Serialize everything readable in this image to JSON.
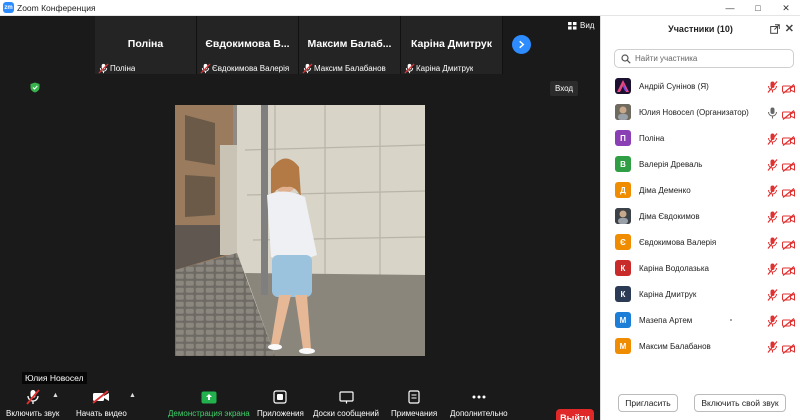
{
  "window": {
    "title": "Zoom Конференция",
    "logo_text": "zm",
    "controls": [
      "minimize",
      "maximize",
      "close"
    ]
  },
  "thumbnails": [
    {
      "big_name": "Поліна",
      "footer_name": "Поліна"
    },
    {
      "big_name": "Євдокимова В...",
      "footer_name": "Євдокимова Валерія"
    },
    {
      "big_name": "Максим Балаб...",
      "footer_name": "Максим Балабанов"
    },
    {
      "big_name": "Каріна Дмитрук",
      "footer_name": "Каріна Дмитрук"
    }
  ],
  "view_label": "Вид",
  "enter_label": "Вход",
  "active_speaker_tag": "Юлия Новосел",
  "toolbar": {
    "unmute": "Включить звук",
    "start_video": "Начать видео",
    "share_screen": "Демонстрация экрана",
    "apps": "Приложения",
    "whiteboards": "Доски сообщений",
    "notes": "Примечания",
    "more": "Дополнительно",
    "leave": "Выйти"
  },
  "panel": {
    "title": "Участники (10)",
    "search_placeholder": "Найти участника",
    "invite_label": "Пригласить",
    "unmute_me_label": "Включить свой звук",
    "participants": [
      {
        "name": "Андрій Сунінов (Я)",
        "initial": "",
        "avatar": "logo",
        "color": "#1b1030",
        "mic": "off",
        "video": "off"
      },
      {
        "name": "Юлия Новосел (Организатор)",
        "initial": "",
        "avatar": "photo",
        "color": "#6f6a60",
        "mic": "on",
        "video": "off"
      },
      {
        "name": "Поліна",
        "initial": "П",
        "avatar": "letter",
        "color": "#8a3fb5",
        "mic": "off",
        "video": "off"
      },
      {
        "name": "Валерія Древаль",
        "initial": "В",
        "avatar": "letter",
        "color": "#2f9e44",
        "mic": "off",
        "video": "off"
      },
      {
        "name": "Діма Деменко",
        "initial": "Д",
        "avatar": "letter",
        "color": "#f08c00",
        "mic": "off",
        "video": "off"
      },
      {
        "name": "Діма Євдокимов",
        "initial": "",
        "avatar": "photo",
        "color": "#3d4148",
        "mic": "off",
        "video": "off"
      },
      {
        "name": "Євдокимова Валерія",
        "initial": "Є",
        "avatar": "letter",
        "color": "#f08c00",
        "mic": "off",
        "video": "off"
      },
      {
        "name": "Каріна Водолазька",
        "initial": "К",
        "avatar": "letter",
        "color": "#c92a2a",
        "mic": "off",
        "video": "off"
      },
      {
        "name": "Каріна Дмитрук",
        "initial": "К",
        "avatar": "letter",
        "color": "#2b3a55",
        "mic": "off",
        "video": "off"
      },
      {
        "name": "Мазепа Артем",
        "initial": "М",
        "avatar": "letter",
        "color": "#1c7ed6",
        "mic": "off",
        "video": "off"
      },
      {
        "name": "Максим Балабанов",
        "initial": "М",
        "avatar": "letter",
        "color": "#f08c00",
        "mic": "off",
        "video": "off"
      }
    ]
  }
}
